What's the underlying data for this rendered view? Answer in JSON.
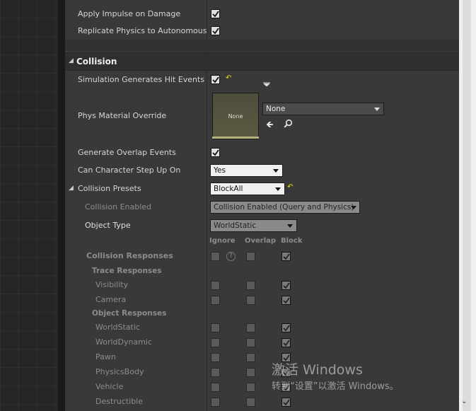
{
  "physics": {
    "apply_impulse_label": "Apply Impulse on Damage",
    "replicate_label": "Replicate Physics to Autonomous Pr"
  },
  "collision": {
    "section_title": "Collision",
    "sim_hit_events_label": "Simulation Generates Hit Events",
    "phys_material_label": "Phys Material Override",
    "phys_material_thumb": "None",
    "phys_material_value": "None",
    "overlap_events_label": "Generate Overlap Events",
    "step_up_label": "Can Character Step Up On",
    "step_up_value": "Yes",
    "presets_label": "Collision Presets",
    "presets_value": "BlockAll",
    "enabled_label": "Collision Enabled",
    "enabled_value": "Collision Enabled (Query and Physics)",
    "object_type_label": "Object Type",
    "object_type_value": "WorldStatic",
    "col_ignore": "Ignore",
    "col_overlap": "Overlap",
    "col_block": "Block",
    "responses_label": "Collision Responses",
    "trace_label": "Trace Responses",
    "object_responses_label": "Object Responses",
    "responses": [
      {
        "label": "Visibility"
      },
      {
        "label": "Camera"
      },
      {
        "label": "WorldStatic"
      },
      {
        "label": "WorldDynamic"
      },
      {
        "label": "Pawn"
      },
      {
        "label": "PhysicsBody"
      },
      {
        "label": "Vehicle"
      },
      {
        "label": "Destructible"
      }
    ]
  },
  "watermark": {
    "line1": "激活 Windows",
    "line2": "转到“设置”以激活 Windows。"
  }
}
